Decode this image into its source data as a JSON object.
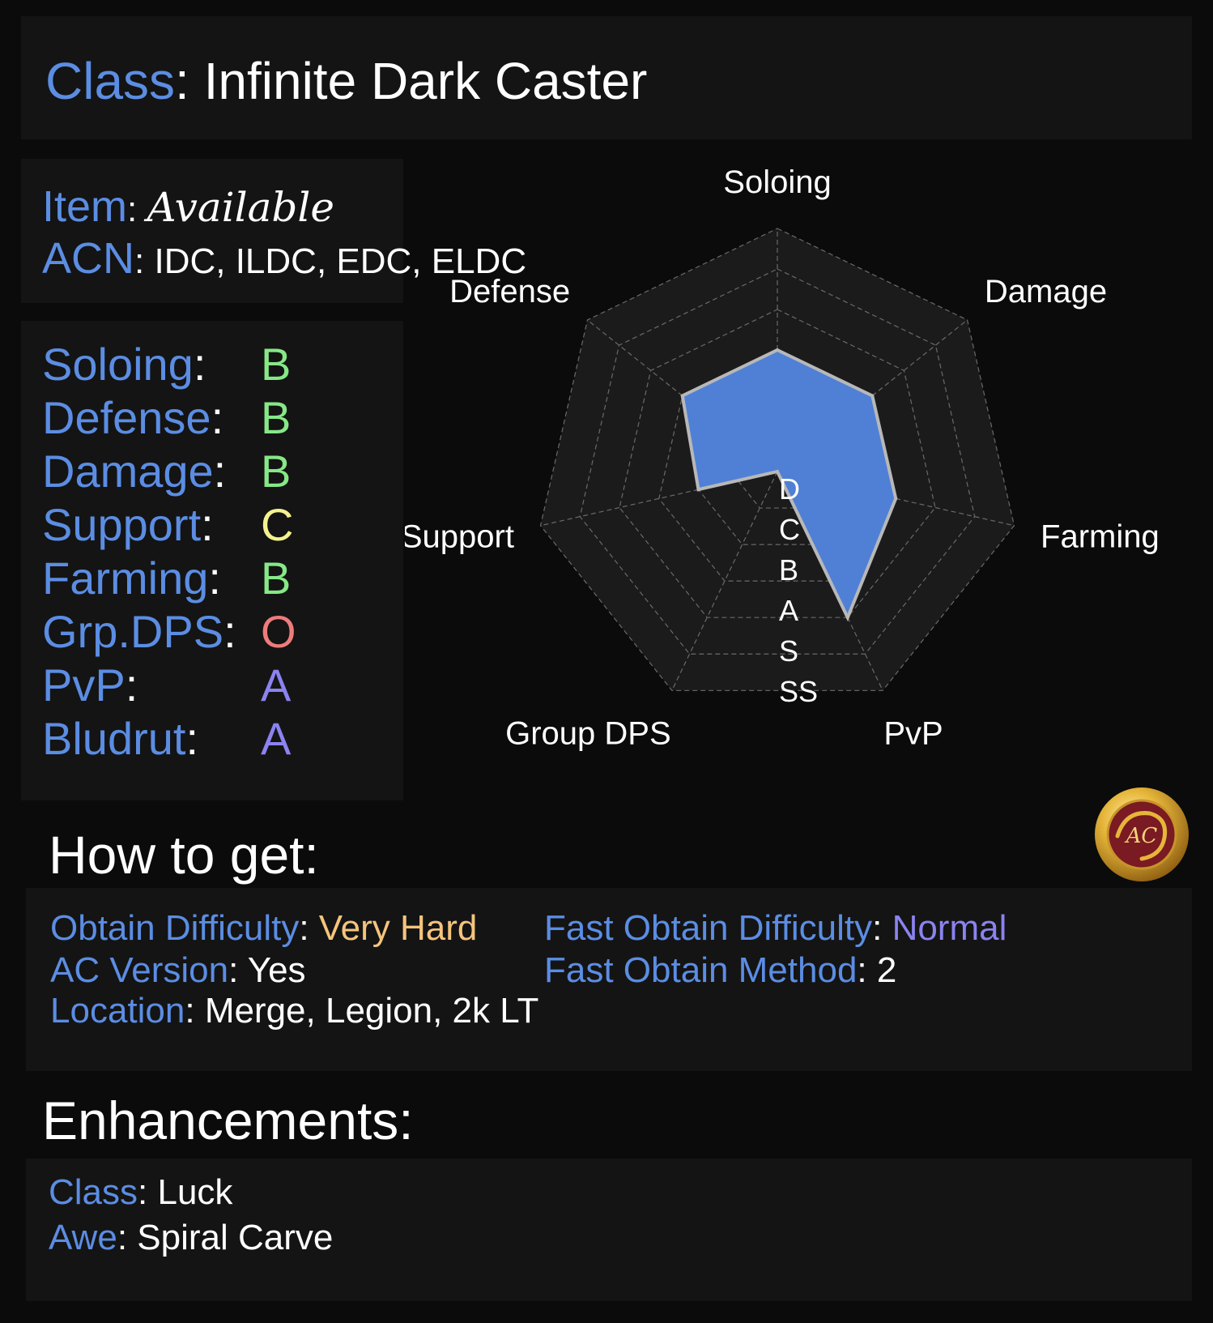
{
  "colors": {
    "background": "#0b0b0b",
    "panel": "#141414",
    "label_blue": "#5b8de3",
    "grade_B": "#86e886",
    "grade_C": "#f4f28e",
    "grade_O": "#ef7b7b",
    "grade_A": "#8b83f0",
    "very_hard": "#f5c47c",
    "normal": "#8b83f0",
    "radar_fill": "#4f80d6",
    "radar_outline": "#b8b8b8"
  },
  "header": {
    "class_label": "Class",
    "class_value": "Infinite Dark Caster"
  },
  "item": {
    "item_label": "Item",
    "item_value": "Available",
    "acn_label": "ACN",
    "acn_value": "IDC, ILDC, EDC, ELDC"
  },
  "ratings": [
    {
      "label": "Soloing",
      "grade": "B",
      "color": "#86e886"
    },
    {
      "label": "Defense",
      "grade": "B",
      "color": "#86e886"
    },
    {
      "label": "Damage",
      "grade": "B",
      "color": "#86e886"
    },
    {
      "label": "Support",
      "grade": "C",
      "color": "#f4f28e"
    },
    {
      "label": "Farming",
      "grade": "B",
      "color": "#86e886"
    },
    {
      "label": "Grp.DPS",
      "grade": "O",
      "color": "#ef7b7b"
    },
    {
      "label": "PvP",
      "grade": "A",
      "color": "#8b83f0"
    },
    {
      "label": "Bludrut",
      "grade": "A",
      "color": "#8b83f0"
    }
  ],
  "radar": {
    "axes": [
      "Soloing",
      "Damage",
      "Farming",
      "PvP",
      "Group DPS",
      "Support",
      "Defense"
    ],
    "scale_labels": [
      "D",
      "C",
      "B",
      "A",
      "S",
      "SS"
    ],
    "levels": 6,
    "values": [
      3,
      3,
      3,
      4,
      0,
      2,
      3
    ]
  },
  "logo": {
    "text": "AC",
    "icon": "ac-dragon-emblem"
  },
  "how_to_get": {
    "heading": "How to get:",
    "obtain_difficulty_label": "Obtain Difficulty",
    "obtain_difficulty_value": "Very Hard",
    "fast_obtain_difficulty_label": "Fast Obtain Difficulty",
    "fast_obtain_difficulty_value": "Normal",
    "ac_version_label": "AC Version",
    "ac_version_value": "Yes",
    "fast_obtain_method_label": "Fast Obtain Method",
    "fast_obtain_method_value": "2",
    "location_label": "Location",
    "location_value": "Merge, Legion, 2k LT"
  },
  "enhancements": {
    "heading": "Enhancements:",
    "class_label": "Class",
    "class_value": "Luck",
    "awe_label": "Awe",
    "awe_value": "Spiral Carve"
  }
}
